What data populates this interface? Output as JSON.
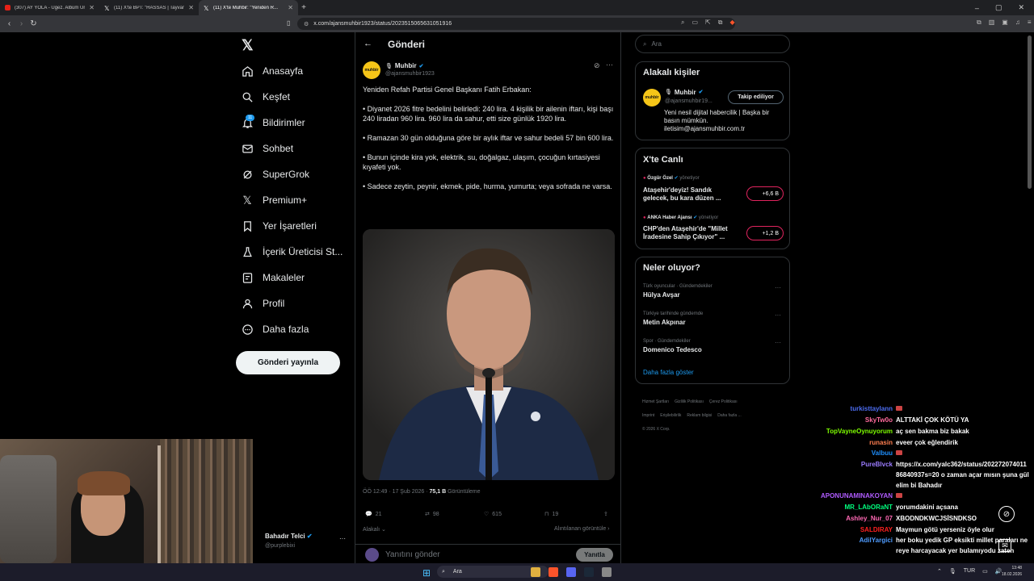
{
  "browser": {
    "tabs": [
      {
        "title": "(307) AY YOLA - Ugez. Albüm Ural B...",
        "fav": "#e62117"
      },
      {
        "title": "(11) X'te BPT: \"HASSAS | Tayvan'da o...",
        "fav": "#ffffff"
      },
      {
        "title": "(11) X'te Muhbir: \"Yeniden R...",
        "fav": "#ffffff"
      }
    ],
    "url": "x.com/ajansmuhbir1923/status/2023515065631051916"
  },
  "nav": {
    "items": [
      {
        "label": "Anasayfa",
        "icon": "home-icon"
      },
      {
        "label": "Keşfet",
        "icon": "search-icon"
      },
      {
        "label": "Bildirimler",
        "icon": "bell-icon"
      },
      {
        "label": "Sohbet",
        "icon": "mail-icon"
      },
      {
        "label": "SuperGrok",
        "icon": "grok-icon"
      },
      {
        "label": "Premium+",
        "icon": "x-logo-icon"
      },
      {
        "label": "Yer İşaretleri",
        "icon": "bookmark-icon"
      },
      {
        "label": "İçerik Üreticisi St...",
        "icon": "flask-icon"
      },
      {
        "label": "Makaleler",
        "icon": "article-icon"
      },
      {
        "label": "Profil",
        "icon": "user-icon"
      },
      {
        "label": "Daha fazla",
        "icon": "more-circle-icon"
      }
    ],
    "notification_count": "11",
    "post_button": "Gönderi yayınla",
    "account": {
      "name": "Bahadır Telci",
      "handle": "@purplebixi"
    }
  },
  "main": {
    "header": "Gönderi",
    "author": {
      "name": "Muhbir",
      "handle": "@ajansmuhbir1923",
      "avatar_text": "muhbir"
    },
    "text": "Yeniden Refah Partisi Genel Başkanı Fatih Erbakan:\n\n• Diyanet 2026 fitre bedelini belirledi: 240 lira. 4 kişilik bir ailenin iftarı, kişi başı 240 liradan 960 lira. 960 lira da sahur, etti size günlük 1920 lira.\n\n• Ramazan 30 gün olduğuna göre bir aylık iftar ve sahur bedeli 57 bin 600 lira.\n\n• Bunun içinde kira yok, elektrik, su, doğalgaz, ulaşım, çocuğun kırtasiyesi kıyafeti yok.\n\n• Sadece zeytin, peynir, ekmek, pide, hurma, yumurta; veya sofrada ne varsa.",
    "time": "ÖÖ 12:49 · 17 Şub 2026 · ",
    "views": "75,1 B",
    "views_label": " Görüntüleme",
    "actions": {
      "replies": "21",
      "reposts": "98",
      "likes": "615",
      "bookmarks": "19"
    },
    "related_left": "Alakalı",
    "related_right": "Alıntılanan görüntüle",
    "reply_placeholder": "Yanıtını gönder",
    "reply_button": "Yanıtla"
  },
  "right": {
    "search_placeholder": "Ara",
    "related_title": "Alakalı kişiler",
    "related_person": {
      "name": "Muhbir",
      "handle": "@ajansmuhbir19...",
      "follow": "Takip ediliyor",
      "bio": "Yeni nesil dijital habercilik | Başka bir basın mümkün. iletisim@ajansmuhbir.com.tr"
    },
    "live_title": "X'te Canlı",
    "live": [
      {
        "user": "Özgür Özel",
        "role": "yönetiyor",
        "title": "Ataşehir'deyiz! Sandık gelecek, bu kara düzen ...",
        "count": "+6,6 B"
      },
      {
        "user": "ANKA Haber Ajansı",
        "role": "yönetiyor",
        "title": "CHP'den Ataşehir'de \"Millet İradesine Sahip Çıkıyor\" ...",
        "count": "+1,2 B"
      }
    ],
    "trends_title": "Neler oluyor?",
    "trends": [
      {
        "meta": "Türk oyuncular · Gündemdekiler",
        "name": "Hülya Avşar"
      },
      {
        "meta": "Türkiye tarihinde gündemde",
        "name": "Metin Akpınar"
      },
      {
        "meta": "Spor · Gündemdekiler",
        "name": "Domenico Tedesco"
      }
    ],
    "show_more": "Daha fazla göster",
    "footer": [
      "Hizmet Şartları",
      "Gizlilik Politikası",
      "Çerez Politikası",
      "Imprint",
      "Erişilebilirlik",
      "Reklam bilgisi",
      "Daha fazla ...",
      "© 2026 X Corp."
    ]
  },
  "chat": [
    {
      "user": "turkisttaylann",
      "color": "#4c6cf0",
      "msg": ""
    },
    {
      "user": "SkyTw0o",
      "color": "#ff6b9d",
      "msg": "ALTTAKİ ÇOK KÖTÜ YA"
    },
    {
      "user": "TopVayneOynuyorum",
      "color": "#7fff00",
      "msg": "aç sen bakma biz bakak"
    },
    {
      "user": "runasin",
      "color": "#ff7f50",
      "msg": "eveer çok eğlendirik"
    },
    {
      "user": "Valbuu",
      "color": "#1e90ff",
      "msg": ""
    },
    {
      "user": "PureBlvck",
      "color": "#9b7cff",
      "msg": "https://x.com/yalc362/status/20227207401186840937s=20 o zaman açar mısın şuna gülelim bi Bahadır"
    },
    {
      "user": "APONUNAMINAKOYAN",
      "color": "#b05cff",
      "msg": ""
    },
    {
      "user": "MR_LAbORaNT",
      "color": "#00ff7f",
      "msg": "yorumdakini açsana"
    },
    {
      "user": "Ashley_Nur_07",
      "color": "#ff69b4",
      "msg": "XBODNDKWCJSİSNDKSO"
    },
    {
      "user": "SALDIRAY",
      "color": "#ff2020",
      "msg": "Maymun götü yerseniz öyle olur"
    },
    {
      "user": "AdilYargici",
      "color": "#4f9cff",
      "msg": "her boku yedik GP eksikti millet paraları nereye harcayacak yer bulamıyodu zaten"
    }
  ],
  "taskbar": {
    "search": "Ara",
    "lang": "TUR",
    "time": "13:48",
    "date": "18.02.2026"
  }
}
